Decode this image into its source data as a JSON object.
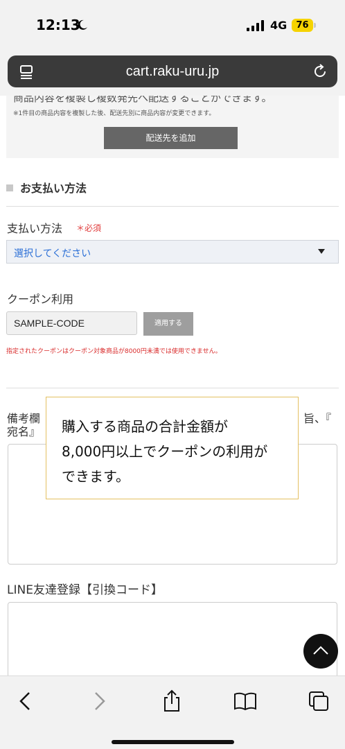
{
  "status_bar": {
    "time": "12:13",
    "network": "4G",
    "battery": "76"
  },
  "browser": {
    "url": "cart.raku-uru.jp"
  },
  "info_box": {
    "cut_text": "商品内容を複製し複数発先へ配送することができます。",
    "note": "※1件目の商品内容を複製した後、配送先別に商品内容が変更できます。",
    "add_destination_label": "配送先を追加"
  },
  "payment": {
    "section_title": "お支払い方法",
    "label": "支払い方法",
    "required_label": "＊必須",
    "select_value": "選択してください"
  },
  "coupon": {
    "label": "クーポン利用",
    "input_value": "SAMPLE-CODE",
    "apply_label": "適用する",
    "error": "指定されたクーポンはクーポン対象商品が8000円未満では使用できません。"
  },
  "memo": {
    "label_line1": "備考欄",
    "label_tail": "旨、『",
    "label_line2": "宛名』"
  },
  "line": {
    "label": "LINE友達登録【引換コード】"
  },
  "tooltip": {
    "line1": "購入する商品の合計金額が",
    "line2": "8,000円以上でクーポンの利用が",
    "line3": "できます。"
  },
  "colors": {
    "accent_error": "#d92b2b",
    "select_link": "#2b6fd6",
    "tooltip_border": "#e4c061",
    "battery": "#f5d300"
  },
  "icons": {
    "toolbar": [
      "back-icon",
      "forward-icon",
      "share-icon",
      "bookmarks-icon",
      "tabs-icon"
    ],
    "url_bar": [
      "reader-icon",
      "reload-icon"
    ],
    "scroll": "chevron-up-icon"
  }
}
